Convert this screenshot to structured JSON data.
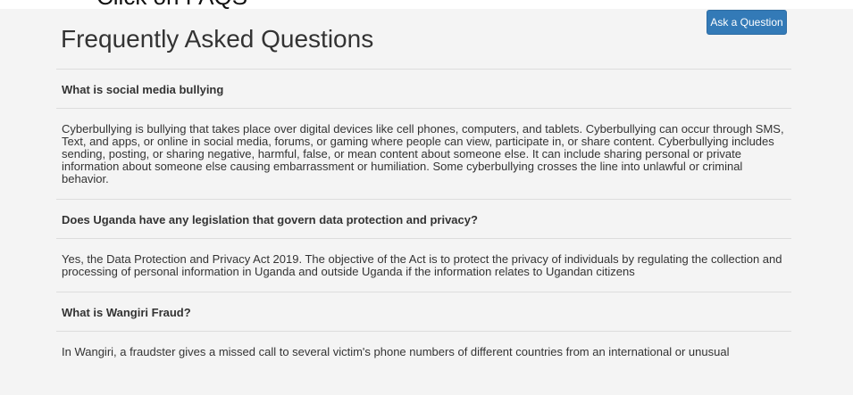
{
  "caption": "Click on FAQS",
  "header": {
    "title": "Frequently Asked Questions",
    "ask_button_label": "Ask a Question"
  },
  "faqs": [
    {
      "question": "What is social media bullying",
      "answer": "Cyberbullying is bullying that takes place over digital devices like cell phones, computers, and tablets. Cyberbullying can occur through SMS, Text, and apps, or online in social media, forums, or gaming where people can view, participate in, or share content. Cyberbullying includes sending, posting, or sharing negative, harmful, false, or mean content about someone else. It can include sharing personal or private information about someone else causing embarrassment or humiliation. Some cyberbullying crosses the line into unlawful or criminal behavior."
    },
    {
      "question": "Does Uganda have any legislation that govern data protection and privacy?",
      "answer": "Yes, the Data Protection and Privacy Act 2019. The objective of the Act is to protect the privacy of individuals by regulating the collection and processing of personal information in Uganda and outside Uganda if the information relates to Ugandan citizens"
    },
    {
      "question": "What is Wangiri Fraud?",
      "answer": "In Wangiri, a fraudster gives a missed call to several victim's phone numbers of different countries from an international or unusual"
    }
  ],
  "colors": {
    "primary_button": "#337ab7",
    "page_background": "#f4f4f4",
    "divider": "#dddddd",
    "text": "#333333"
  }
}
